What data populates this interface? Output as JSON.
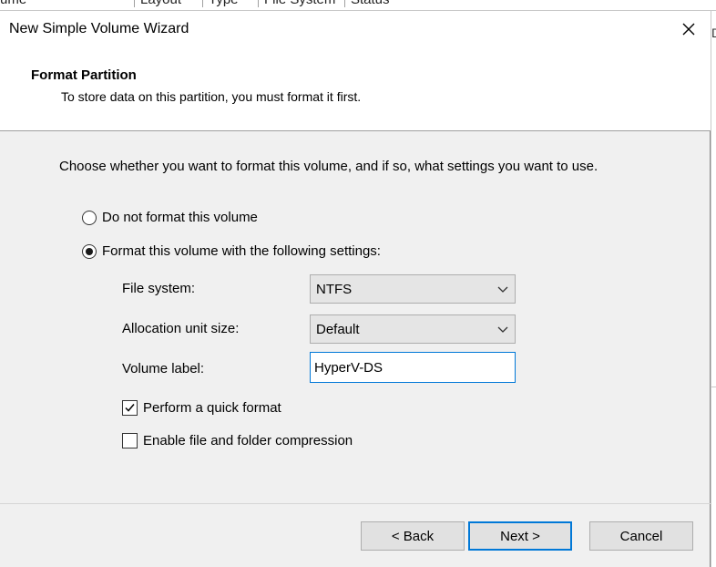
{
  "background_window": {
    "columns": [
      "ume",
      "Layout",
      "Type",
      "File System",
      "Status"
    ],
    "right_glyph": "D"
  },
  "dialog": {
    "title": "New Simple Volume Wizard",
    "header": {
      "title": "Format Partition",
      "subtitle": "To store data on this partition, you must format it first."
    },
    "intro": "Choose whether you want to format this volume, and if so, what settings you want to use.",
    "options": {
      "no_format": {
        "label": "Do not format this volume",
        "selected": false
      },
      "format": {
        "label": "Format this volume with the following settings:",
        "selected": true
      }
    },
    "fields": {
      "file_system": {
        "label": "File system:",
        "value": "NTFS"
      },
      "allocation_unit_size": {
        "label": "Allocation unit size:",
        "value": "Default"
      },
      "volume_label": {
        "label": "Volume label:",
        "value": "HyperV-DS"
      }
    },
    "checkboxes": {
      "quick_format": {
        "label": "Perform a quick format",
        "checked": true
      },
      "compression": {
        "label": "Enable file and folder compression",
        "checked": false
      }
    },
    "buttons": {
      "back": "< Back",
      "next": "Next >",
      "cancel": "Cancel"
    },
    "icons": {
      "close": "close-icon",
      "dropdown": "chevron-down-icon",
      "check": "checkmark-icon"
    },
    "colors": {
      "focus_accent": "#0078d7",
      "header_background": "#ffffff",
      "body_background": "#f0f0f0"
    }
  }
}
